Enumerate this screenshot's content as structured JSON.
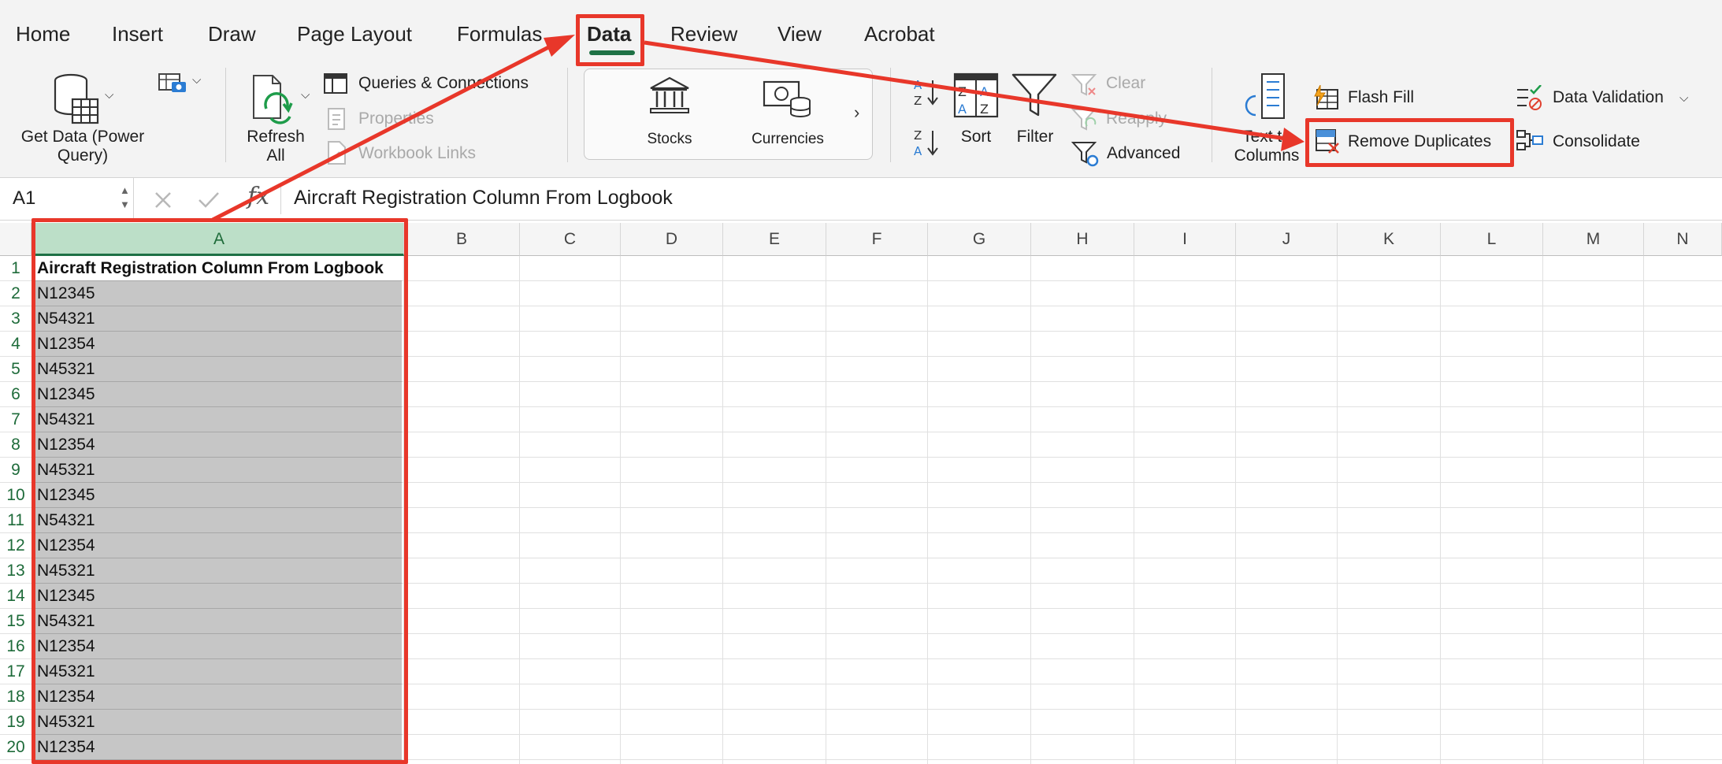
{
  "ribbon": {
    "tabs": [
      {
        "label": "Home"
      },
      {
        "label": "Insert"
      },
      {
        "label": "Draw"
      },
      {
        "label": "Page Layout"
      },
      {
        "label": "Formulas"
      },
      {
        "label": "Data"
      },
      {
        "label": "Review"
      },
      {
        "label": "View"
      },
      {
        "label": "Acrobat"
      }
    ],
    "active_tab": "Data",
    "get_data": {
      "line1": "Get Data (Power",
      "line2": "Query)"
    },
    "refresh": {
      "line1": "Refresh",
      "line2": "All"
    },
    "queries_connections": "Queries & Connections",
    "properties": "Properties",
    "workbook_links": "Workbook Links",
    "stocks": "Stocks",
    "currencies": "Currencies",
    "sort": "Sort",
    "filter": "Filter",
    "clear": "Clear",
    "reapply": "Reapply",
    "advanced": "Advanced",
    "text_to_columns": {
      "line1": "Text to",
      "line2": "Columns"
    },
    "flash_fill": "Flash Fill",
    "remove_duplicates": "Remove Duplicates",
    "data_validation": "Data Validation",
    "consolidate": "Consolidate"
  },
  "formula_bar": {
    "name_box": "A1",
    "fx": "fx",
    "content": "Aircraft Registration Column From Logbook"
  },
  "sheet": {
    "columns": [
      "A",
      "B",
      "C",
      "D",
      "E",
      "F",
      "G",
      "H",
      "I",
      "J",
      "K",
      "L",
      "M",
      "N"
    ],
    "rows": [
      "1",
      "2",
      "3",
      "4",
      "5",
      "6",
      "7",
      "8",
      "9",
      "10",
      "11",
      "12",
      "13",
      "14",
      "15",
      "16",
      "17",
      "18",
      "19",
      "20"
    ],
    "column_a": [
      "Aircraft Registration Column From Logbook",
      "N12345",
      "N54321",
      "N12354",
      "N45321",
      "N12345",
      "N54321",
      "N12354",
      "N45321",
      "N12345",
      "N54321",
      "N12354",
      "N45321",
      "N12345",
      "N54321",
      "N12354",
      "N45321",
      "N12354",
      "N45321",
      "N12354"
    ]
  },
  "colors": {
    "highlight": "#e8372a",
    "excel_green": "#1e7145",
    "selection_gray": "#c6c6c6"
  }
}
